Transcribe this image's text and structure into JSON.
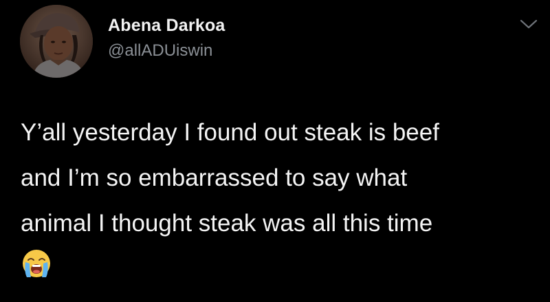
{
  "tweet": {
    "display_name": "Abena Darkoa",
    "handle": "@allADUiswin",
    "text_lines": [
      "Y’all yesterday I found out steak is beef",
      "and I’m so embarrassed to say what",
      "animal I thought steak was all this time"
    ],
    "emoji_icon": "loudly-crying-face-icon",
    "menu_icon": "chevron-down-icon"
  },
  "colors": {
    "background": "#000000",
    "name": "#f2f2f2",
    "handle": "#8b9096",
    "text": "#f4f4f4"
  }
}
